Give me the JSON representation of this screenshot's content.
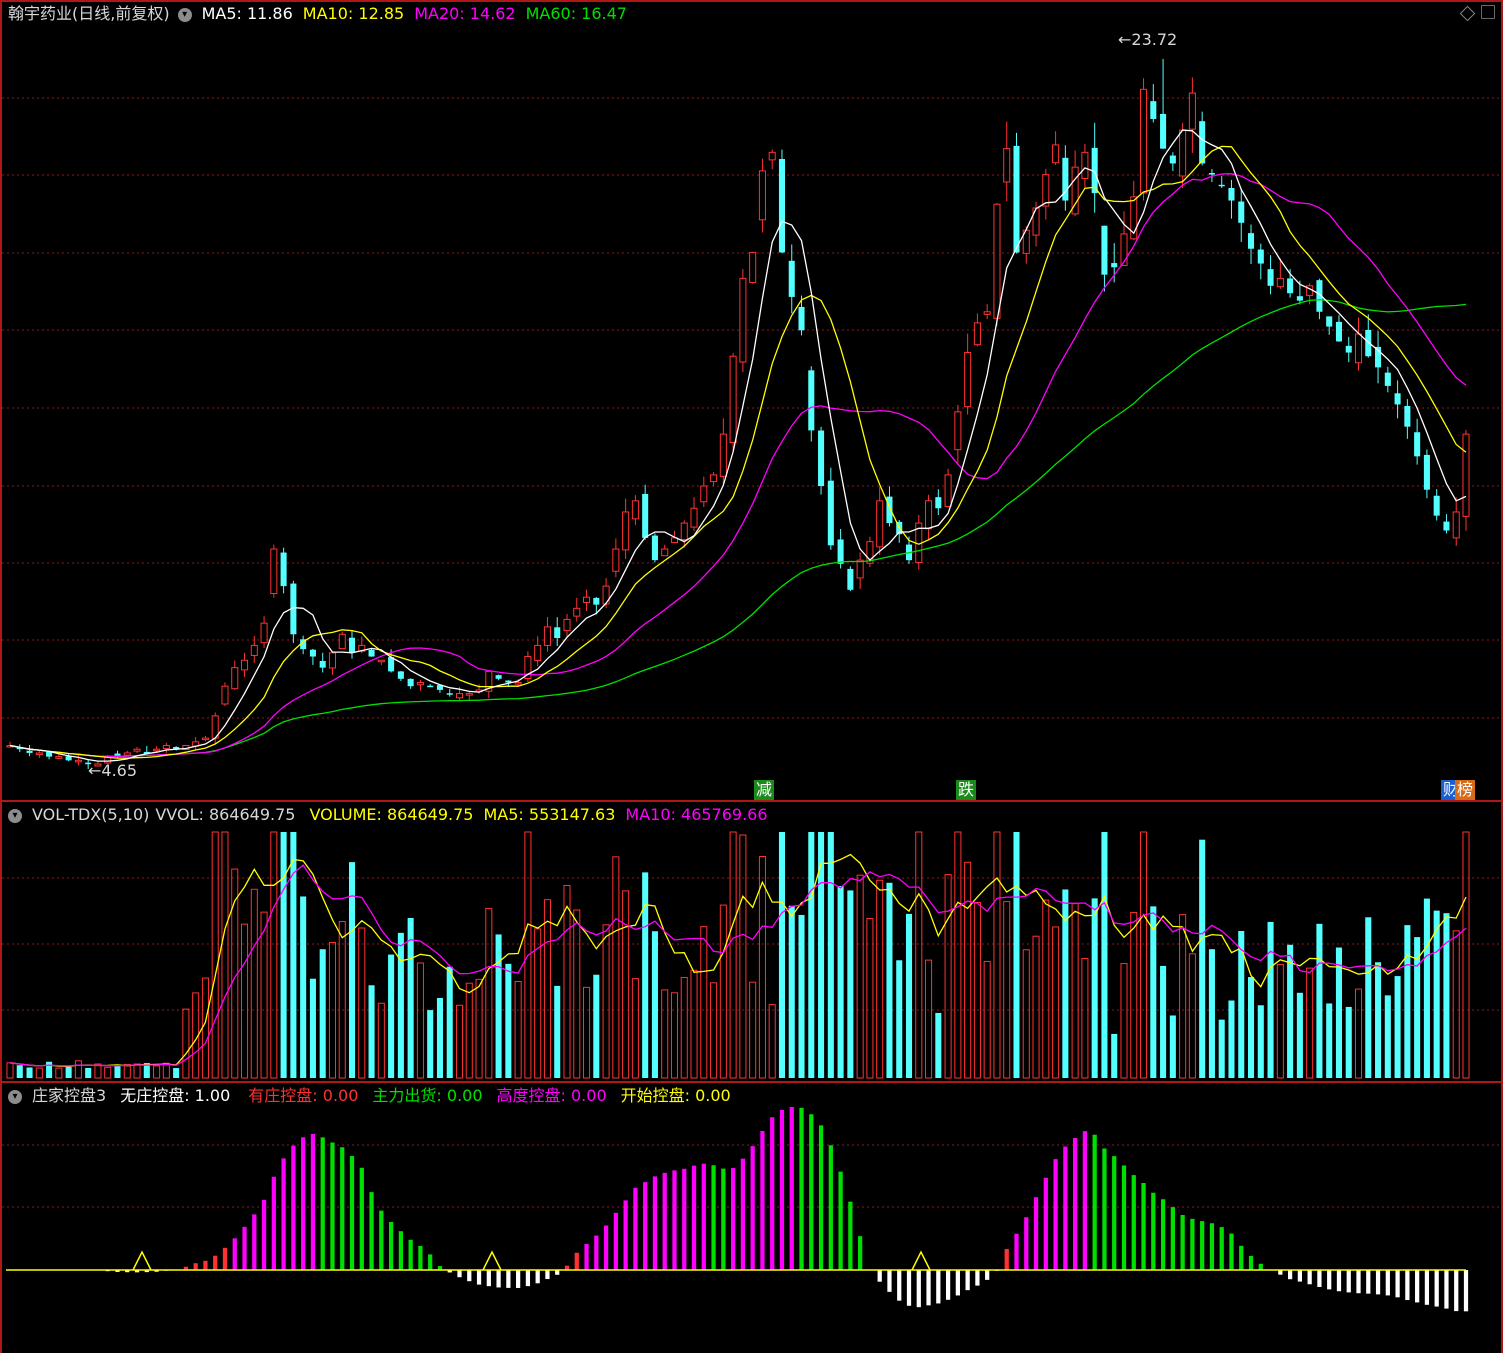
{
  "main_header": {
    "stock": "翰宇药业(日线,前复权)",
    "ma5": "MA5: 11.86",
    "ma10": "MA10: 12.85",
    "ma20": "MA20: 14.62",
    "ma60": "MA60: 16.47"
  },
  "markers": {
    "high": "23.72",
    "low": "4.65",
    "tag_jian": "减",
    "tag_die": "跌",
    "tag_cai": "财",
    "tag_bang": "榜"
  },
  "vol_header": {
    "name": "VOL-TDX(5,10)",
    "vvol": "VVOL: 864649.75",
    "volume": "VOLUME: 864649.75",
    "ma5": "MA5: 553147.63",
    "ma10": "MA10: 465769.66"
  },
  "ind_header": {
    "name": "庄家控盘3",
    "wuzhuang": "无庄控盘: 1.00",
    "youzhuang": "有庄控盘: 0.00",
    "zhuli": "主力出货: 0.00",
    "gaodu": "高度控盘: 0.00",
    "kaishi": "开始控盘: 0.00"
  },
  "colors": {
    "up": "#ff3232",
    "down": "#54ffff",
    "ma5": "#ffffff",
    "ma10": "#ffff00",
    "ma20": "#ff00ff",
    "ma60": "#00e000",
    "frame": "#b01818",
    "grid": "#8a1a1a"
  },
  "chart_data": [
    {
      "type": "candlestick",
      "title": "翰宇药业(日线,前复权)",
      "y_range": [
        4.0,
        24.5
      ],
      "high_mark": 23.72,
      "low_mark": 4.65,
      "series": [
        {
          "name": "MA5",
          "value": 11.86
        },
        {
          "name": "MA10",
          "value": 12.85
        },
        {
          "name": "MA20",
          "value": 14.62
        },
        {
          "name": "MA60",
          "value": 16.47
        }
      ],
      "closes": [
        5.2,
        5.1,
        5.0,
        5.0,
        4.9,
        4.9,
        4.8,
        4.8,
        4.7,
        4.7,
        4.9,
        4.9,
        5.0,
        5.1,
        5.0,
        5.1,
        5.2,
        5.1,
        5.2,
        5.3,
        5.4,
        6.0,
        6.8,
        7.3,
        7.5,
        7.9,
        8.5,
        10.5,
        9.5,
        8.2,
        7.8,
        7.6,
        7.3,
        7.7,
        8.2,
        7.7,
        7.9,
        7.6,
        7.5,
        7.2,
        7.0,
        6.8,
        6.9,
        6.8,
        6.7,
        6.6,
        6.6,
        6.6,
        6.7,
        7.2,
        7.0,
        6.9,
        6.9,
        7.6,
        7.9,
        8.4,
        8.1,
        8.6,
        8.9,
        9.2,
        9.0,
        9.5,
        10.5,
        11.5,
        11.8,
        10.8,
        10.2,
        10.5,
        10.8,
        11.2,
        11.6,
        12.2,
        12.5,
        13.6,
        15.7,
        17.8,
        18.5,
        20.7,
        21.2,
        18.5,
        17.3,
        16.4,
        13.7,
        12.2,
        10.6,
        10.1,
        9.4,
        10.2,
        10.7,
        11.8,
        11.2,
        10.9,
        10.2,
        11.2,
        11.8,
        11.6,
        12.5,
        14.2,
        15.8,
        16.6,
        16.9,
        19.8,
        21.3,
        18.5,
        19.1,
        19.7,
        20.6,
        21.4,
        19.9,
        20.8,
        21.2,
        20.1,
        17.9,
        18.1,
        19.0,
        20.0,
        22.9,
        22.1,
        21.3,
        20.9,
        21.8,
        22.8,
        20.9,
        20.6,
        20.3,
        19.9,
        19.3,
        18.6,
        18.2,
        17.6,
        17.8,
        17.4,
        17.2,
        17.6,
        16.9,
        16.5,
        16.1,
        15.8,
        16.3,
        15.7,
        15.4,
        14.9,
        14.4,
        13.8,
        13.0,
        12.1,
        11.4,
        11.0,
        11.5,
        13.6
      ]
    },
    {
      "type": "bar",
      "title": "VOL-TDX(5,10)",
      "series": [
        {
          "name": "VOLUME",
          "value": 864649.75
        },
        {
          "name": "MA5",
          "value": 553147.63
        },
        {
          "name": "MA10",
          "value": 465769.66
        }
      ]
    },
    {
      "type": "bar",
      "title": "庄家控盘3",
      "series": [
        {
          "name": "无庄控盘",
          "value": 1.0
        },
        {
          "name": "有庄控盘",
          "value": 0.0
        },
        {
          "name": "主力出货",
          "value": 0.0
        },
        {
          "name": "高度控盘",
          "value": 0.0
        },
        {
          "name": "开始控盘",
          "value": 0.0
        }
      ]
    }
  ]
}
